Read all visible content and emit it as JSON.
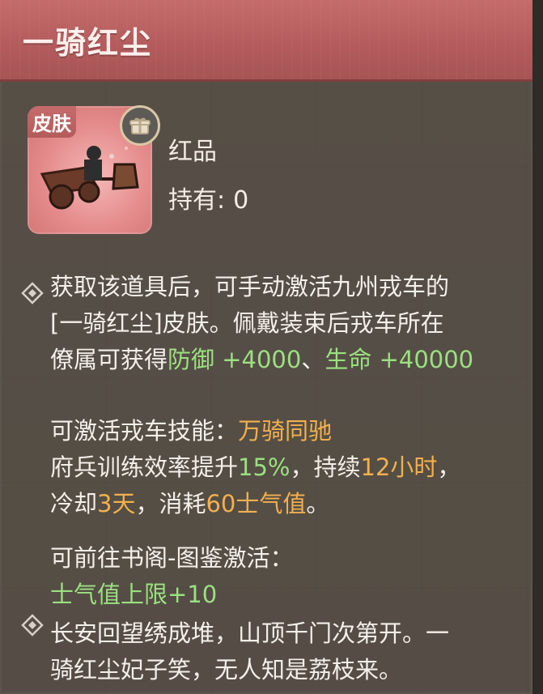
{
  "item": {
    "title": "一骑红尘",
    "tag": "皮肤",
    "rarity": "红品",
    "owned_label": "持有:",
    "owned_value": "0"
  },
  "desc1": {
    "line1": "获取该道具后，可手动激活九州戎车的",
    "line2": "[一骑红尘]皮肤。佩戴装束后戎车所在",
    "line3_prefix": "僚属可获得",
    "defense": "防御 +4000",
    "sep": "、",
    "life": "生命 +40000"
  },
  "skill": {
    "label": "可激活戎车技能：",
    "name": "万骑同驰",
    "line2_prefix": "府兵训练效率提升",
    "pct": "15%",
    "line2_mid": "，持续",
    "duration": "12小时",
    "line2_suffix": "，",
    "line3_prefix": "冷却",
    "cooldown": "3天",
    "line3_mid": "，消耗",
    "cost": "60士气值",
    "line3_suffix": "。"
  },
  "atlas": {
    "label": "可前往书阁-图鉴激活：",
    "bonus": "士气值上限+10"
  },
  "poem": {
    "line1": "长安回望绣成堆，山顶千门次第开。一",
    "line2": "骑红尘妃子笑，无人知是荔枝来。"
  },
  "colors": {
    "title_bg": "#b35b5c",
    "panel_bg": "#463f38",
    "text": "#f3efe9",
    "green": "#9be080",
    "gold": "#f2b04f"
  },
  "icons": [
    "diamond-bullet-icon",
    "gift-icon"
  ]
}
